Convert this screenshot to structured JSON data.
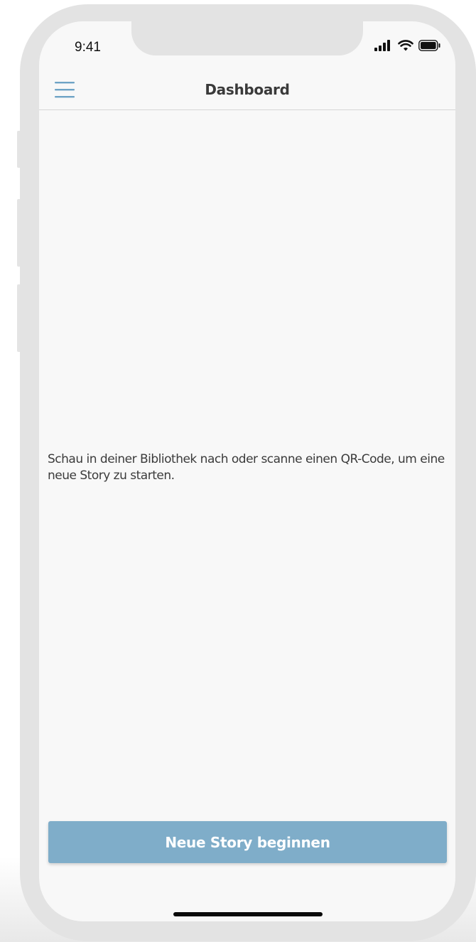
{
  "status_bar": {
    "time": "9:41",
    "icons": [
      "cellular-signal-icon",
      "wifi-icon",
      "battery-icon"
    ]
  },
  "nav": {
    "title": "Dashboard",
    "menu_icon": "hamburger-menu-icon"
  },
  "main": {
    "empty_message": "Schau in deiner Bibliothek nach oder scanne einen QR-Code, um eine neue Story zu starten."
  },
  "actions": {
    "new_story_label": "Neue Story beginnen"
  },
  "colors": {
    "accent": "#7fadc9",
    "menu_icon": "#6ea3c5",
    "background": "#f8f8f8",
    "device_frame": "#e3e3e3"
  }
}
